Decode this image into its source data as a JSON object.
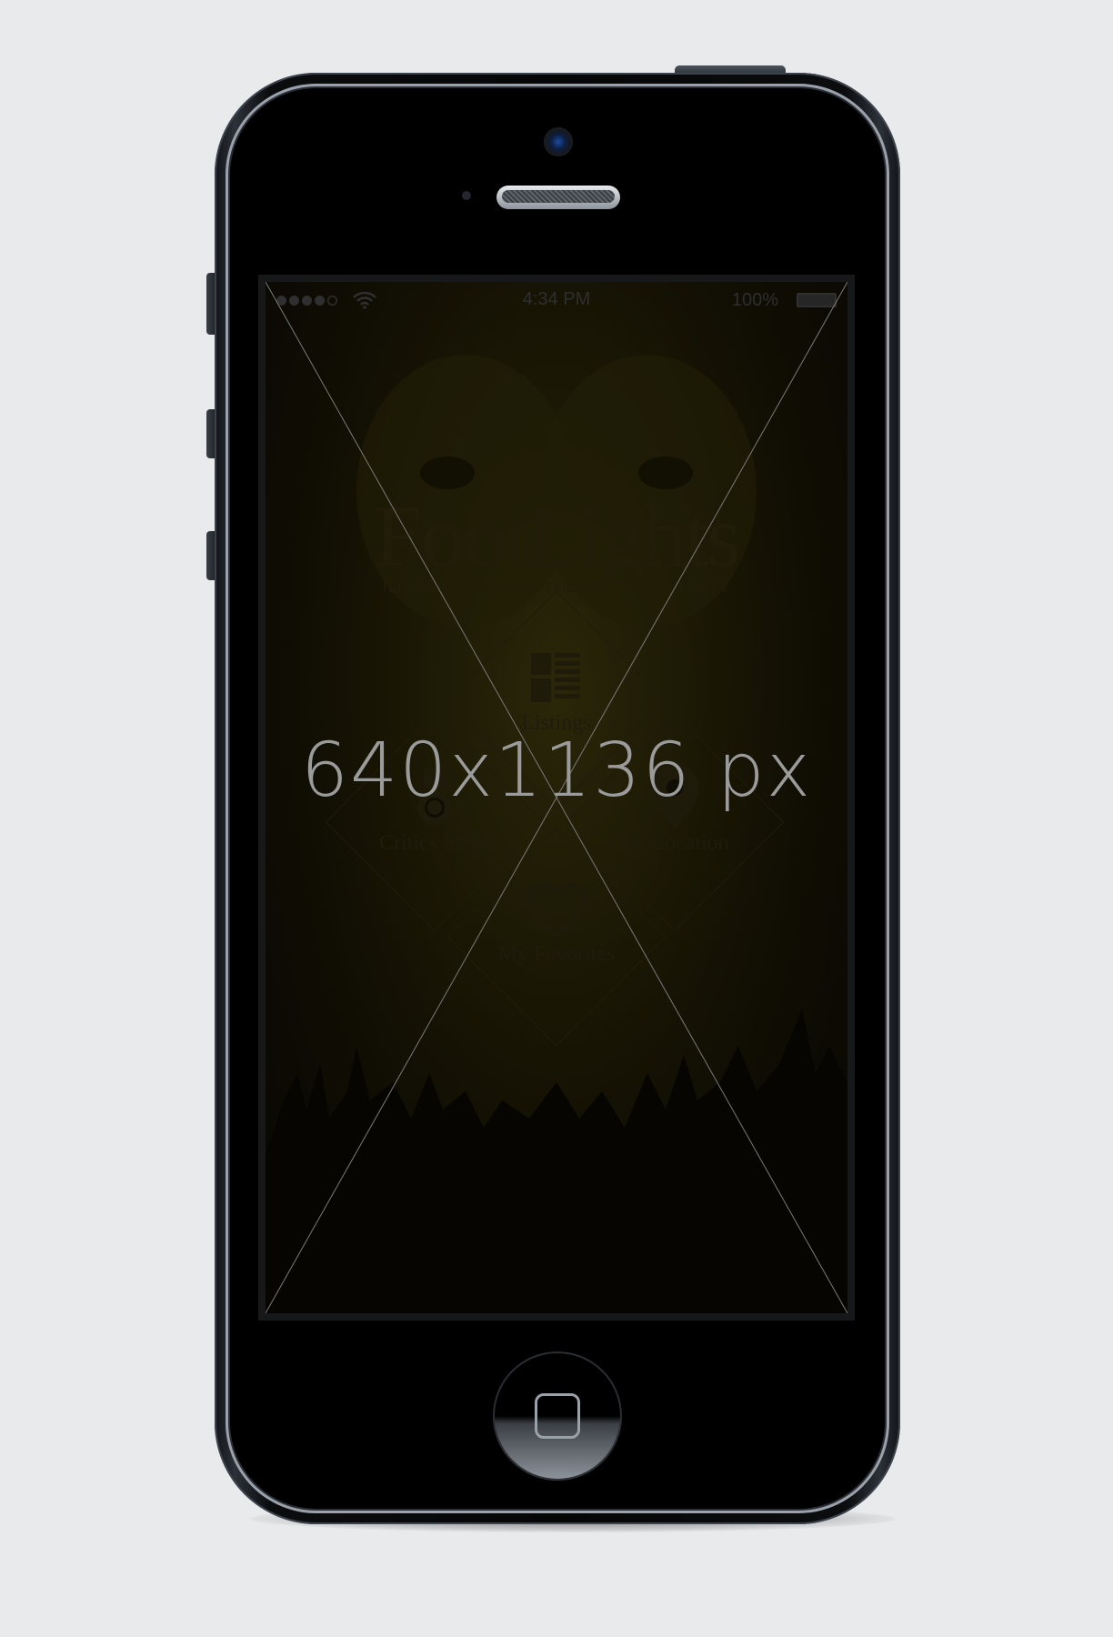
{
  "status_bar": {
    "time": "4:34 PM",
    "battery_percent": "100%",
    "signal_bars_filled": 4,
    "signal_bars_total": 5
  },
  "app": {
    "logo": "FootLights",
    "tagline": "ILLUMINATING THE THEATRE COMMUNITY"
  },
  "menu": {
    "listings": "Listings",
    "critics_picks": "Critics Picks",
    "by_location": "By Location",
    "my_favorites": "My Favorites"
  },
  "placeholder": {
    "label": "640x1136 px"
  },
  "colors": {
    "background": "#e9eaec",
    "screen_tint": "#191604",
    "placeholder_text": "#9b9b9b"
  },
  "icons": {
    "listings": "listings-grid-icon",
    "critics_picks": "medal-icon",
    "by_location": "map-pin-icon",
    "my_favorites": "heart-icon"
  }
}
